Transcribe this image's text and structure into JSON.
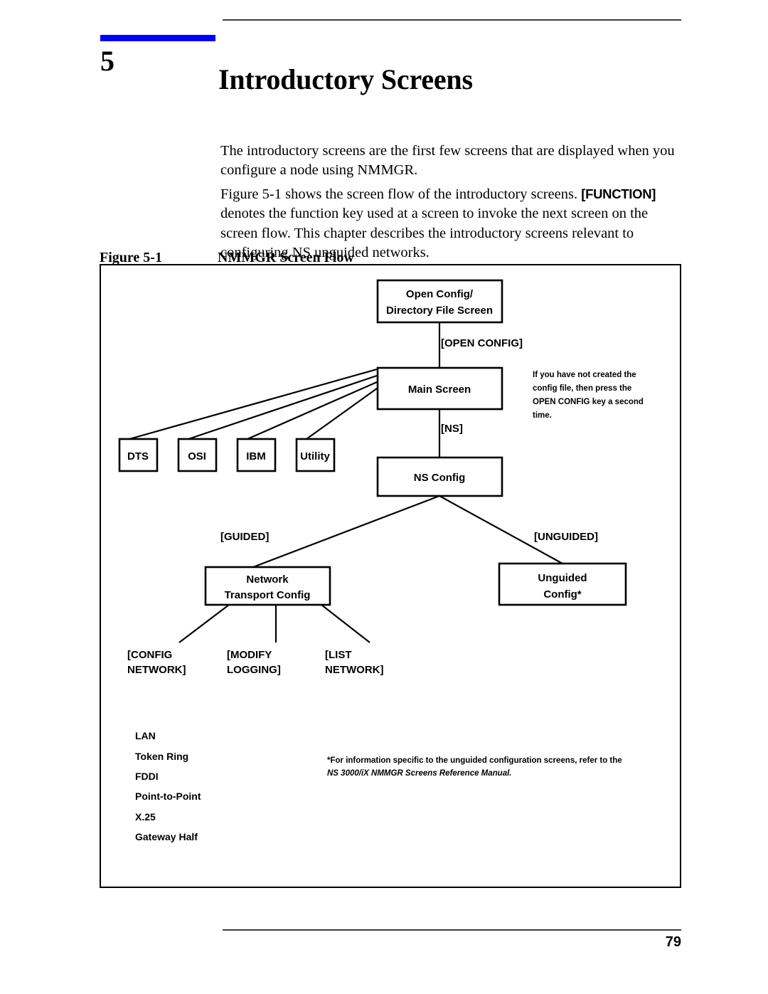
{
  "page": {
    "chapter_number": "5",
    "chapter_title": "Introductory Screens",
    "page_number": "79",
    "accent_color": "#0000ff",
    "rule_color": "#3a3f44"
  },
  "body": {
    "para_intro": "The introductory screens are the first few screens that are displayed when you configure a node using NMMGR.",
    "para_figref_before": "Figure 5-1 shows the screen flow of the introductory screens. ",
    "para_figref_key": "[FUNCTION]",
    "para_figref_after": " denotes the function key used at a screen to invoke the next screen on the screen flow. This chapter describes the introductory screens relevant to configuring NS unguided networks."
  },
  "figure": {
    "label": "Figure 5-1",
    "title": "NMMGR Screen Flow",
    "nodes": {
      "open_config": {
        "line1": "Open Config/",
        "line2": "Directory File Screen"
      },
      "main_screen": {
        "line1": "Main Screen"
      },
      "ns_config": {
        "line1": "NS Config"
      },
      "dts": {
        "line1": "DTS"
      },
      "osi": {
        "line1": "OSI"
      },
      "ibm": {
        "line1": "IBM"
      },
      "utility": {
        "line1": "Utility"
      },
      "network_transport_config": {
        "line1": "Network",
        "line2": "Transport Config"
      },
      "unguided_config": {
        "line1": "Unguided",
        "line2": "Config*"
      }
    },
    "function_keys": {
      "open_config": "[OPEN CONFIG]",
      "ns": "[NS]",
      "guided": "[GUIDED]",
      "unguided": "[UNGUIDED]",
      "config_network_l1": "[CONFIG",
      "config_network_l2": "NETWORK]",
      "modify_logging_l1": "[MODIFY",
      "modify_logging_l2": "LOGGING]",
      "list_network_l1": "[LIST",
      "list_network_l2": "NETWORK]"
    },
    "note": {
      "line1": "If you have not created the",
      "line2": "config file, then press the",
      "line3": "OPEN CONFIG key a second",
      "line4": "time."
    },
    "network_types": [
      "LAN",
      "Token Ring",
      "FDDI",
      "Point-to-Point",
      "X.25",
      "Gateway Half"
    ],
    "footnote": {
      "line1": "*For information specific to the unguided configuration screens, refer to the",
      "line2": "NS 3000/iX NMMGR Screens Reference Manual."
    }
  }
}
